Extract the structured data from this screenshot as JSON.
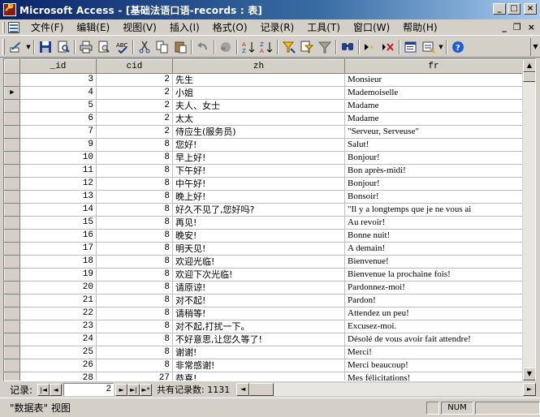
{
  "window": {
    "title": "Microsoft Access - [基础法语口语-records : 表]",
    "minimize_glyph": "_",
    "maximize_glyph": "□",
    "close_glyph": "×"
  },
  "menubar": {
    "items": [
      {
        "label": "文件(F)"
      },
      {
        "label": "编辑(E)"
      },
      {
        "label": "视图(V)"
      },
      {
        "label": "插入(I)"
      },
      {
        "label": "格式(O)"
      },
      {
        "label": "记录(R)"
      },
      {
        "label": "工具(T)"
      },
      {
        "label": "窗口(W)"
      },
      {
        "label": "帮助(H)"
      }
    ],
    "mdi_minimize": "_",
    "mdi_restore": "❐",
    "mdi_close": "×"
  },
  "toolbar": {
    "icons": [
      "design-view-icon",
      "save-icon",
      "search-file-icon",
      "print-icon",
      "print-preview-icon",
      "spelling-icon",
      "cut-icon",
      "copy-icon",
      "paste-icon",
      "undo-icon",
      "hyperlink-icon",
      "sort-ascending-icon",
      "sort-descending-icon",
      "filter-by-selection-icon",
      "filter-by-form-icon",
      "apply-filter-icon",
      "find-icon",
      "new-record-icon",
      "delete-record-icon",
      "properties-icon",
      "database-window-icon",
      "help-icon"
    ]
  },
  "table": {
    "columns": [
      "_id",
      "cid",
      "zh",
      "fr"
    ],
    "current_row_index": 1,
    "rows": [
      {
        "id": "3",
        "cid": "2",
        "zh": "先生",
        "fr": "Monsieur"
      },
      {
        "id": "4",
        "cid": "2",
        "zh": "小姐",
        "fr": "Mademoiselle"
      },
      {
        "id": "5",
        "cid": "2",
        "zh": "夫人、女士",
        "fr": "Madame"
      },
      {
        "id": "6",
        "cid": "2",
        "zh": "太太",
        "fr": "Madame"
      },
      {
        "id": "7",
        "cid": "2",
        "zh": "侍应生(服务员)",
        "fr": "\"Serveur, Serveuse\""
      },
      {
        "id": "9",
        "cid": "8",
        "zh": "您好!",
        "fr": "Salut!"
      },
      {
        "id": "10",
        "cid": "8",
        "zh": "早上好!",
        "fr": "Bonjour!"
      },
      {
        "id": "11",
        "cid": "8",
        "zh": "下午好!",
        "fr": "Bon après-midi!"
      },
      {
        "id": "12",
        "cid": "8",
        "zh": "中午好!",
        "fr": "Bonjour!"
      },
      {
        "id": "13",
        "cid": "8",
        "zh": "晚上好!",
        "fr": "Bonsoir!"
      },
      {
        "id": "14",
        "cid": "8",
        "zh": "好久不见了,您好吗?",
        "fr": "\"Il y a longtemps que je ne vous ai"
      },
      {
        "id": "15",
        "cid": "8",
        "zh": "再见!",
        "fr": "Au revoir!"
      },
      {
        "id": "16",
        "cid": "8",
        "zh": "晚安!",
        "fr": "Bonne nuit!"
      },
      {
        "id": "17",
        "cid": "8",
        "zh": "明天见!",
        "fr": "A demain!"
      },
      {
        "id": "18",
        "cid": "8",
        "zh": "欢迎光临!",
        "fr": "Bienvenue!"
      },
      {
        "id": "19",
        "cid": "8",
        "zh": "欢迎下次光临!",
        "fr": "Bienvenue la prochaine fois!"
      },
      {
        "id": "20",
        "cid": "8",
        "zh": "请原谅!",
        "fr": "Pardonnez-moi!"
      },
      {
        "id": "21",
        "cid": "8",
        "zh": "对不起!",
        "fr": "Pardon!"
      },
      {
        "id": "22",
        "cid": "8",
        "zh": "请稍等!",
        "fr": "Attendez un peu!"
      },
      {
        "id": "23",
        "cid": "8",
        "zh": "对不起,打扰一下。",
        "fr": "Excusez-moi."
      },
      {
        "id": "24",
        "cid": "8",
        "zh": "不好意思,让您久等了!",
        "fr": "Désolé de vous avoir fait attendre!"
      },
      {
        "id": "25",
        "cid": "8",
        "zh": "谢谢!",
        "fr": "Merci!"
      },
      {
        "id": "26",
        "cid": "8",
        "zh": "非常感谢!",
        "fr": "Merci beaucoup!"
      },
      {
        "id": "28",
        "cid": "27",
        "zh": "恭喜!",
        "fr": "Mes félicitations!"
      }
    ]
  },
  "navigator": {
    "label": "记录:",
    "current": "2",
    "first_glyph": "|◄",
    "prev_glyph": "◄",
    "next_glyph": "►",
    "last_glyph": "►|",
    "new_glyph": "►*",
    "count_text": "共有记录数: 1131"
  },
  "statusbar": {
    "text": "\"数据表\" 视图",
    "num": "NUM"
  }
}
